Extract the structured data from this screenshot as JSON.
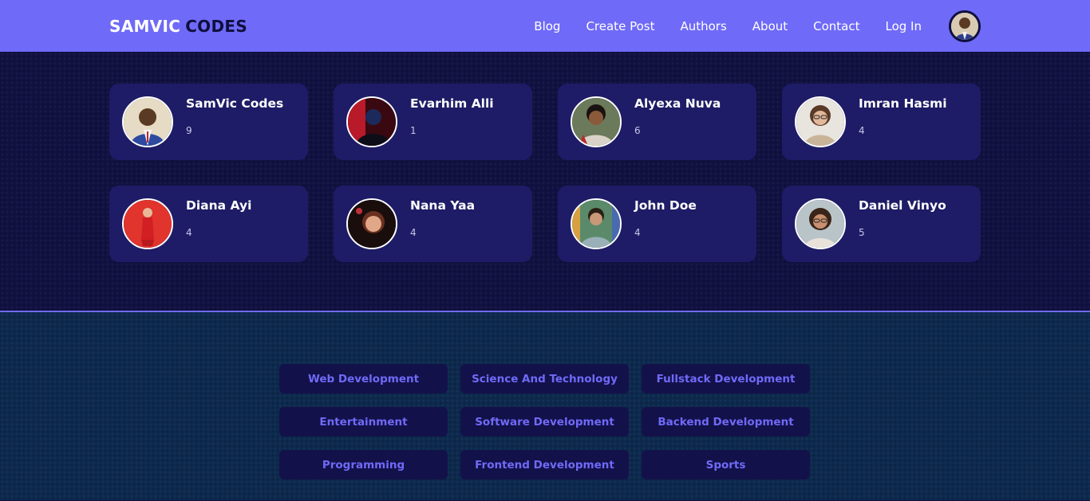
{
  "brand": {
    "first": "SAMVIC",
    "second": "CODES"
  },
  "nav": {
    "links": [
      "Blog",
      "Create Post",
      "Authors",
      "About",
      "Contact",
      "Log In"
    ]
  },
  "authors": [
    {
      "name": "SamVic Codes",
      "count": "9"
    },
    {
      "name": "Evarhim Alli",
      "count": "1"
    },
    {
      "name": "Alyexa Nuva",
      "count": "6"
    },
    {
      "name": "Imran Hasmi",
      "count": "4"
    },
    {
      "name": "Diana Ayi",
      "count": "4"
    },
    {
      "name": "Nana Yaa",
      "count": "4"
    },
    {
      "name": "John Doe",
      "count": "4"
    },
    {
      "name": "Daniel Vinyo",
      "count": "5"
    }
  ],
  "categories": [
    "Web Development",
    "Science And Technology",
    "Fullstack Development",
    "Entertainment",
    "Software Development",
    "Backend Development",
    "Programming",
    "Frontend Development",
    "Sports"
  ],
  "colors": {
    "primary": "#6f6af8",
    "dark": "#0f0f3e",
    "card": "#1e1c66",
    "categoriesBg": "#0d2a4e"
  }
}
